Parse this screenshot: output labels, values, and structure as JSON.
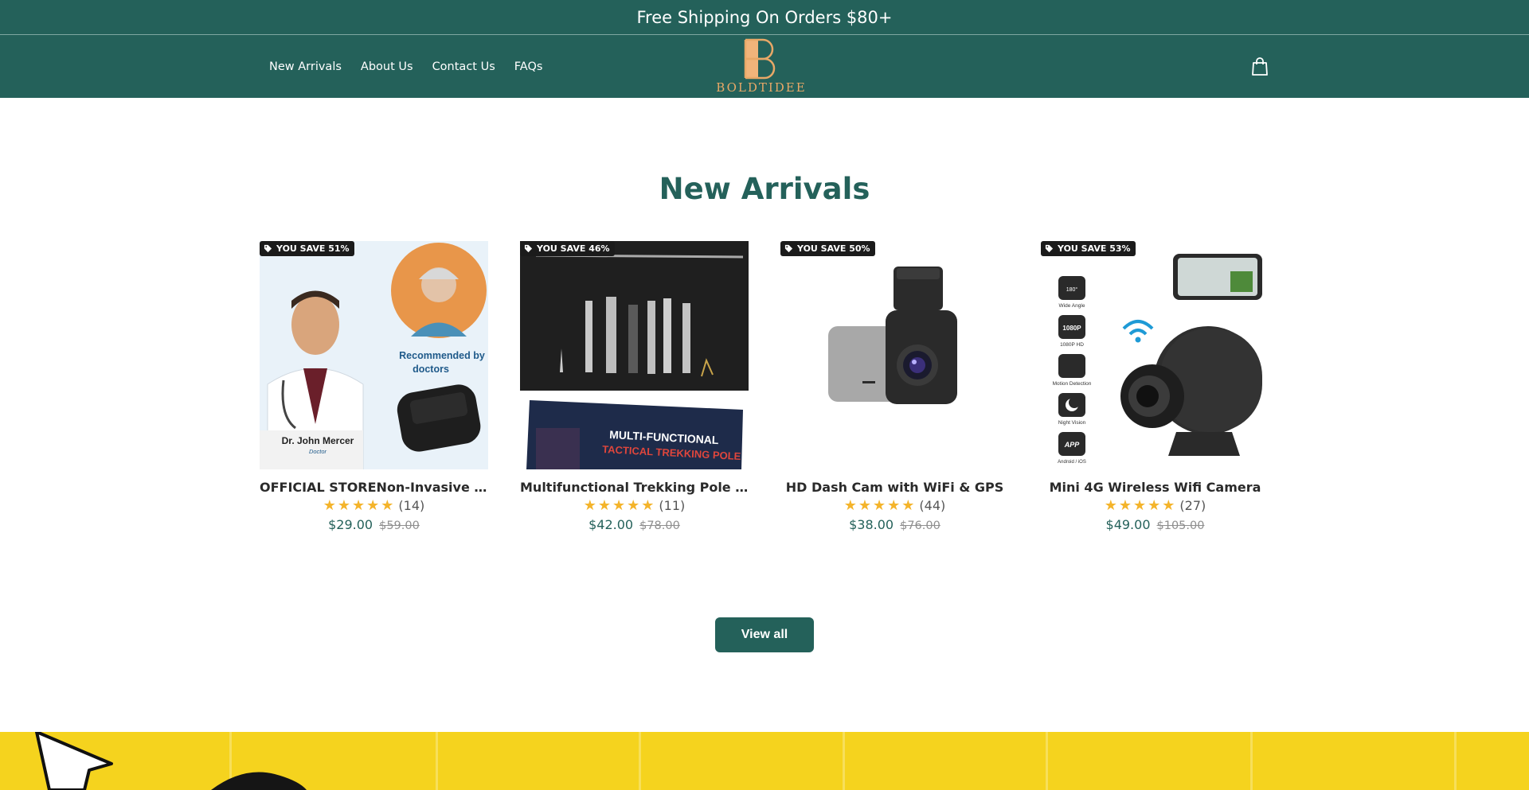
{
  "announcement": {
    "text": "Free Shipping On Orders $80+"
  },
  "nav": {
    "items": [
      {
        "label": "New Arrivals"
      },
      {
        "label": "About Us"
      },
      {
        "label": "Contact Us"
      },
      {
        "label": "FAQs"
      }
    ]
  },
  "logo": {
    "text": "BOLDTIDEE",
    "icon": "logo-b-mark"
  },
  "cart": {
    "icon": "shopping-bag-icon"
  },
  "section": {
    "title": "New Arrivals"
  },
  "products": [
    {
      "badge": "YOU SAVE 51%",
      "title": "OFFICIAL STORENon-Invasive Blood Glucose Monitor",
      "rating_count": "(14)",
      "price": "$29.00",
      "compare_price": "$59.00",
      "image_text": {
        "line1": "Recommended by",
        "line2": "doctors",
        "name": "Dr. John Mercer",
        "role": "Doctor"
      }
    },
    {
      "badge": "YOU SAVE 46%",
      "title": "Multifunctional Trekking Pole – Tactical",
      "rating_count": "(11)",
      "price": "$42.00",
      "compare_price": "$78.00",
      "image_text": {
        "line1": "MULTI-FUNCTIONAL",
        "line2": "TACTICAL TREKKING POLE"
      }
    },
    {
      "badge": "YOU SAVE 50%",
      "title": "HD Dash Cam with WiFi & GPS",
      "rating_count": "(44)",
      "price": "$38.00",
      "compare_price": "$76.00"
    },
    {
      "badge": "YOU SAVE 53%",
      "title": "Mini 4G Wireless Wifi Camera",
      "rating_count": "(27)",
      "price": "$49.00",
      "compare_price": "$105.00",
      "image_text": {
        "f1": "Wide Angle",
        "f1i": "180°",
        "f2": "1080P HD",
        "f2i": "1080P",
        "f3": "Motion Detection",
        "f4": "Night Vision",
        "f5": "Android / iOS",
        "f5i": "APP"
      }
    }
  ],
  "buttons": {
    "view_all": "View all"
  },
  "colors": {
    "brand": "#24615a",
    "accent": "#e8a867",
    "star": "#f4b42b",
    "band": "#f5d31e"
  }
}
